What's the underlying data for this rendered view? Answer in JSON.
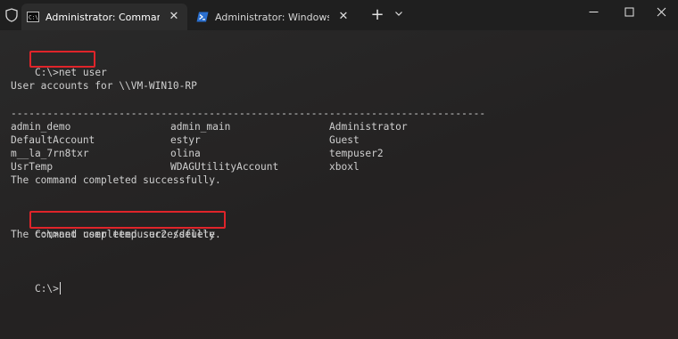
{
  "titlebar": {
    "tabs": [
      {
        "label": "Administrator: Command Prompt",
        "active": true,
        "icon": "cmd-icon"
      },
      {
        "label": "Administrator: Windows PowerShell",
        "active": false,
        "icon": "powershell-icon"
      }
    ],
    "new_tab": "+",
    "dropdown": "⌄",
    "minimize": "—",
    "maximize": "☐",
    "close": "✕"
  },
  "terminal": {
    "prompt1": "C:\\>",
    "cmd1": "net user",
    "accounts_header": "User accounts for \\\\VM-WIN10-RP",
    "separator": "-------------------------------------------------------------------------------",
    "accounts": [
      [
        "admin_demo",
        "admin_main",
        "Administrator"
      ],
      [
        "DefaultAccount",
        "estyr",
        "Guest"
      ],
      [
        "m__la_7rn8txr",
        "olina",
        "tempuser2"
      ],
      [
        "UsrTemp",
        "WDAGUtilityAccount",
        "xboxl"
      ]
    ],
    "completed1": "The command completed successfully.",
    "prompt2": "C:\\>",
    "cmd2": "net user tempuser2 /delete",
    "completed2": "The command completed successfully.",
    "prompt3": "C:\\>"
  },
  "colors": {
    "highlight": "#e0242a",
    "background": "#262424",
    "titlebar": "#1f1f1f"
  }
}
